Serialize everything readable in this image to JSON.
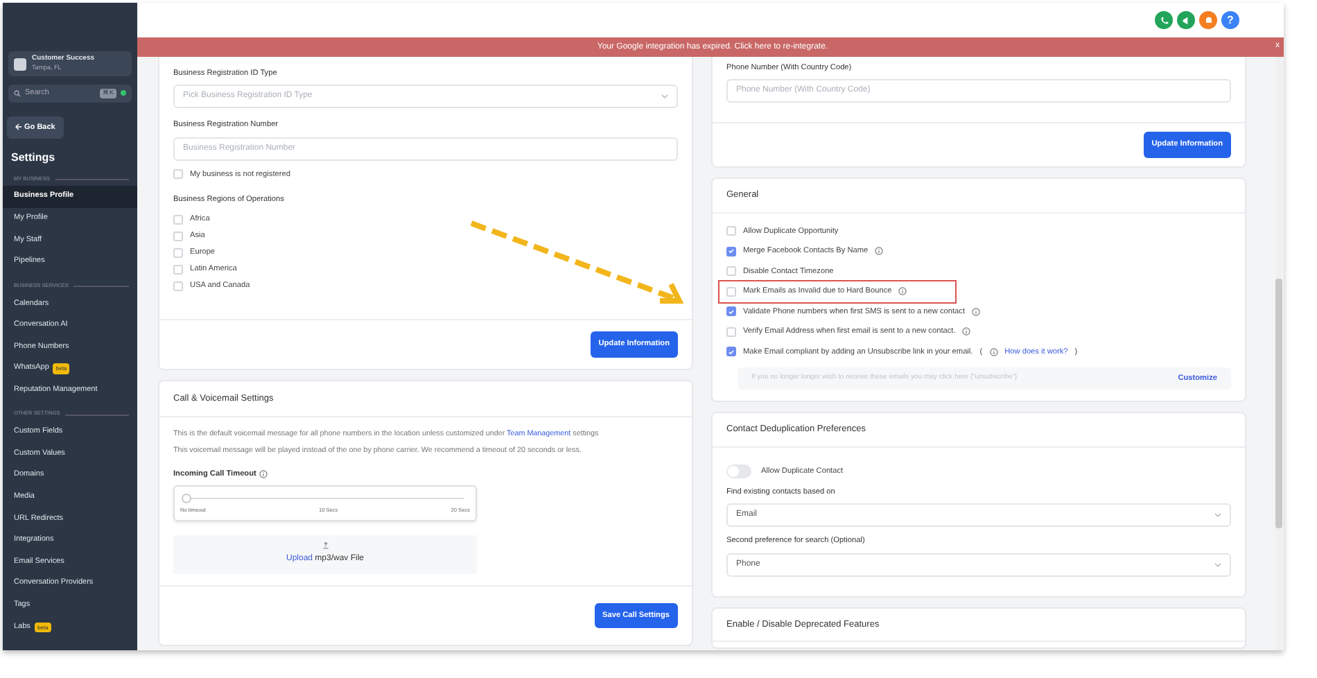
{
  "sidebar": {
    "account": {
      "name": "Customer Success",
      "location": "Tampa, FL"
    },
    "search": {
      "placeholder": "Search",
      "shortcut": "⌘K"
    },
    "back_button": "Go Back",
    "title": "Settings",
    "sections": [
      {
        "heading": "MY BUSINESS",
        "items": [
          {
            "label": "Business Profile",
            "selected": true
          },
          {
            "label": "My Profile",
            "selected": false
          },
          {
            "label": "My Staff",
            "selected": false
          },
          {
            "label": "Pipelines",
            "selected": false
          }
        ]
      },
      {
        "heading": "BUSINESS SERVICES",
        "items": [
          {
            "label": "Calendars",
            "selected": false
          },
          {
            "label": "Conversation AI",
            "selected": false
          },
          {
            "label": "Phone Numbers",
            "selected": false
          },
          {
            "label": "WhatsApp",
            "selected": false,
            "badge": "beta"
          },
          {
            "label": "Reputation Management",
            "selected": false
          }
        ]
      },
      {
        "heading": "OTHER SETTINGS",
        "items": [
          {
            "label": "Custom Fields",
            "selected": false
          },
          {
            "label": "Custom Values",
            "selected": false
          },
          {
            "label": "Domains",
            "selected": false
          },
          {
            "label": "Media",
            "selected": false
          },
          {
            "label": "URL Redirects",
            "selected": false
          },
          {
            "label": "Integrations",
            "selected": false
          },
          {
            "label": "Email Services",
            "selected": false
          },
          {
            "label": "Conversation Providers",
            "selected": false
          },
          {
            "label": "Tags",
            "selected": false
          },
          {
            "label": "Labs",
            "selected": false,
            "badge": "beta"
          }
        ]
      }
    ]
  },
  "header": {
    "help": "?"
  },
  "banner": {
    "text": "Your Google integration has expired. Click here to re-integrate.",
    "close": "x"
  },
  "business_card": {
    "fields": [
      {
        "kind": "select",
        "label": "Business Registration ID Type",
        "placeholder": "Pick Business Registration ID Type"
      },
      {
        "kind": "input",
        "label": "Business Registration Number",
        "placeholder": "Business Registration Number"
      },
      {
        "kind": "checkbox",
        "label": "My business is not registered",
        "checked": false
      },
      {
        "kind": "checkgroup",
        "label": "Business Regions of Operations",
        "options": [
          {
            "label": "Africa",
            "checked": false
          },
          {
            "label": "Asia",
            "checked": false
          },
          {
            "label": "Europe",
            "checked": false
          },
          {
            "label": "Latin America",
            "checked": false
          },
          {
            "label": "USA and Canada",
            "checked": false
          }
        ]
      }
    ],
    "button": "Update Information"
  },
  "call_card": {
    "title": "Call & Voicemail Settings",
    "note": {
      "before": "This is the default voicemail message for all phone numbers in the location unless customized under",
      "link": "Team Management",
      "after": "settings"
    },
    "note_2": "This voicemail message will be played instead of the one by phone carrier. We recommend a timeout of 20 seconds or less.",
    "timeout": {
      "label": "Incoming Call Timeout",
      "level": 0,
      "ticks": [
        "No timeout",
        "10 Secs",
        "20 Secs"
      ]
    },
    "upload": {
      "link": "Upload",
      "text": "mp3/wav File"
    },
    "button": "Save Call Settings"
  },
  "phone_card": {
    "label": "Phone Number (With Country Code)",
    "placeholder": "Phone Number (With Country Code)",
    "button": "Update Information"
  },
  "general_card": {
    "title": "General",
    "options": [
      {
        "label": "Allow Duplicate Opportunity",
        "checked": false,
        "info": false,
        "highlighted": false
      },
      {
        "label": "Merge Facebook Contacts By Name",
        "checked": true,
        "info": true,
        "highlighted": false
      },
      {
        "label": "Disable Contact Timezone",
        "checked": false,
        "info": false,
        "highlighted": false
      },
      {
        "label": "Mark Emails as Invalid due to Hard Bounce",
        "checked": false,
        "info": true,
        "highlighted": true
      },
      {
        "label": "Validate Phone numbers when first SMS is sent to a new contact",
        "checked": true,
        "info": true,
        "highlighted": false
      },
      {
        "label": "Verify Email Address when first email is sent to a new contact.",
        "checked": false,
        "info": true,
        "highlighted": false
      },
      {
        "label": "Make Email compliant by adding an Unsubscribe link in your email.",
        "checked": true,
        "info": true,
        "highlighted": false,
        "paren_open": "(",
        "link": "How does it work?",
        "paren_close": ")"
      }
    ],
    "unsubscribe": {
      "placeholder": "If you no longer longer wish to receive these emails you may click here {\"unsubscribe\"}",
      "button": "Customize"
    }
  },
  "dedup_card": {
    "title": "Contact Deduplication Preferences",
    "toggle": {
      "label": "Allow Duplicate Contact",
      "on": false
    },
    "selects": [
      {
        "label": "Find existing contacts based on",
        "value": "Email"
      },
      {
        "label": "Second preference for search (Optional)",
        "value": "Phone"
      }
    ]
  },
  "deprecated_card": {
    "title": "Enable / Disable Deprecated Features"
  }
}
